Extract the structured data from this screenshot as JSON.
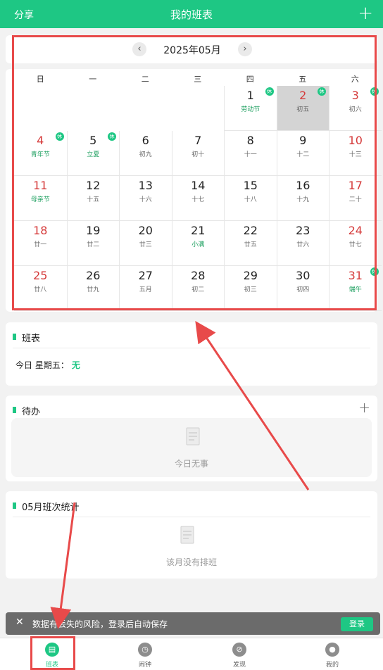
{
  "header": {
    "share": "分享",
    "title": "我的班表",
    "add_icon": "plus-icon"
  },
  "calendar": {
    "month_label": "2025年05月",
    "prev_icon": "chevron-left-icon",
    "next_icon": "chevron-right-icon",
    "weekdays": [
      "日",
      "一",
      "二",
      "三",
      "四",
      "五",
      "六"
    ],
    "days": [
      {
        "day": "1",
        "lunar": "劳动节",
        "red": false,
        "green": true,
        "rest": "休"
      },
      {
        "day": "2",
        "lunar": "初五",
        "red": true,
        "green": false,
        "rest": "休",
        "selected": true
      },
      {
        "day": "3",
        "lunar": "初六",
        "red": true,
        "green": false,
        "rest": "休"
      },
      {
        "day": "4",
        "lunar": "青年节",
        "red": true,
        "green": true,
        "rest": "休"
      },
      {
        "day": "5",
        "lunar": "立夏",
        "red": false,
        "green": true,
        "rest": "休"
      },
      {
        "day": "6",
        "lunar": "初九",
        "red": false,
        "green": false
      },
      {
        "day": "7",
        "lunar": "初十",
        "red": false,
        "green": false
      },
      {
        "day": "8",
        "lunar": "十一",
        "red": false,
        "green": false
      },
      {
        "day": "9",
        "lunar": "十二",
        "red": false,
        "green": false
      },
      {
        "day": "10",
        "lunar": "十三",
        "red": true,
        "green": false
      },
      {
        "day": "11",
        "lunar": "母亲节",
        "red": true,
        "green": true
      },
      {
        "day": "12",
        "lunar": "十五",
        "red": false,
        "green": false
      },
      {
        "day": "13",
        "lunar": "十六",
        "red": false,
        "green": false
      },
      {
        "day": "14",
        "lunar": "十七",
        "red": false,
        "green": false
      },
      {
        "day": "15",
        "lunar": "十八",
        "red": false,
        "green": false
      },
      {
        "day": "16",
        "lunar": "十九",
        "red": false,
        "green": false
      },
      {
        "day": "17",
        "lunar": "二十",
        "red": true,
        "green": false
      },
      {
        "day": "18",
        "lunar": "廿一",
        "red": true,
        "green": false
      },
      {
        "day": "19",
        "lunar": "廿二",
        "red": false,
        "green": false
      },
      {
        "day": "20",
        "lunar": "廿三",
        "red": false,
        "green": false
      },
      {
        "day": "21",
        "lunar": "小满",
        "red": false,
        "green": true
      },
      {
        "day": "22",
        "lunar": "廿五",
        "red": false,
        "green": false
      },
      {
        "day": "23",
        "lunar": "廿六",
        "red": false,
        "green": false
      },
      {
        "day": "24",
        "lunar": "廿七",
        "red": true,
        "green": false
      },
      {
        "day": "25",
        "lunar": "廿八",
        "red": true,
        "green": false
      },
      {
        "day": "26",
        "lunar": "廿九",
        "red": false,
        "green": false
      },
      {
        "day": "27",
        "lunar": "五月",
        "red": false,
        "green": false
      },
      {
        "day": "28",
        "lunar": "初二",
        "red": false,
        "green": false
      },
      {
        "day": "29",
        "lunar": "初三",
        "red": false,
        "green": false
      },
      {
        "day": "30",
        "lunar": "初四",
        "red": false,
        "green": false
      },
      {
        "day": "31",
        "lunar": "端午",
        "red": true,
        "green": true,
        "rest": "休"
      }
    ],
    "first_weekday_index": 4
  },
  "schedule": {
    "title": "班表",
    "today_label": "今日 星期五：",
    "today_value": "无"
  },
  "todo": {
    "title": "待办",
    "add_icon": "plus-icon",
    "empty_text": "今日无事",
    "empty_icon": "document-icon"
  },
  "stats": {
    "title": "05月班次统计",
    "empty_text": "该月没有排班",
    "empty_icon": "document-icon"
  },
  "toast": {
    "close_icon": "close-icon",
    "message": "数据有丢失的风险，登录后自动保存",
    "login": "登录"
  },
  "tabs": [
    {
      "label": "班表",
      "icon": "calendar-icon",
      "active": true
    },
    {
      "label": "闹钟",
      "icon": "clock-icon",
      "active": false
    },
    {
      "label": "发现",
      "icon": "compass-icon",
      "active": false
    },
    {
      "label": "我的",
      "icon": "user-icon",
      "active": false
    }
  ],
  "colors": {
    "primary": "#1ec784",
    "holiday_red": "#d53a3a",
    "annotation_red": "#e84a4a"
  }
}
